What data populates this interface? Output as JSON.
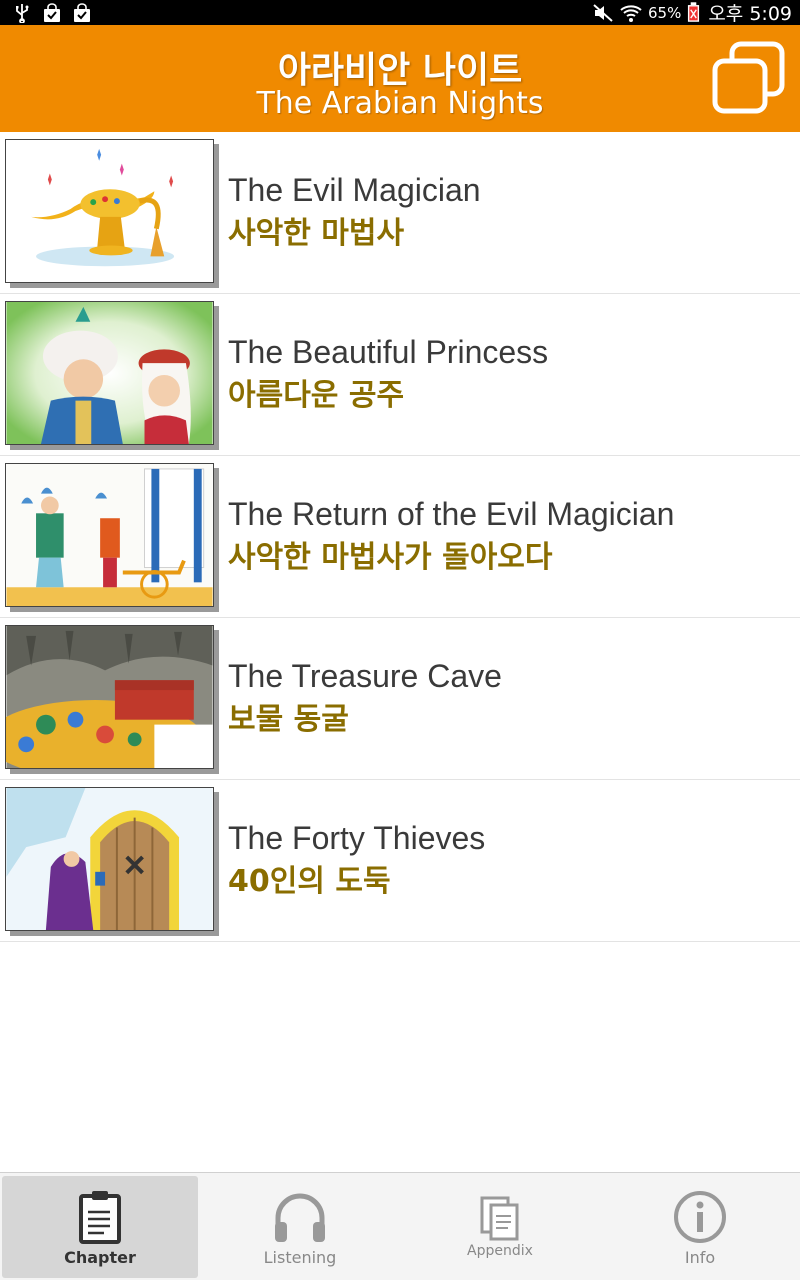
{
  "status_bar": {
    "battery_percent": "65%",
    "time": "오후 5:09"
  },
  "header": {
    "title_korean": "아라비안 나이트",
    "title_english": "The Arabian Nights",
    "window_button_icon": "overlapping-windows-icon"
  },
  "chapters": [
    {
      "title_en": "The Evil Magician",
      "title_ko": "사악한 마법사"
    },
    {
      "title_en": "The Beautiful Princess",
      "title_ko": "아름다운 공주"
    },
    {
      "title_en": "The Return of the Evil Magician",
      "title_ko": "사악한 마법사가 돌아오다"
    },
    {
      "title_en": "The Treasure Cave",
      "title_ko": "보물 동굴"
    },
    {
      "title_en": "The Forty Thieves",
      "title_ko": "40인의 도둑"
    }
  ],
  "bottom_nav": {
    "tabs": [
      {
        "label": "Chapter",
        "icon": "clipboard-icon",
        "active": true
      },
      {
        "label": "Listening",
        "icon": "headphones-icon",
        "active": false
      },
      {
        "label": "Appendix",
        "icon": "documents-icon",
        "active": false
      },
      {
        "label": "Info",
        "icon": "info-icon",
        "active": false
      }
    ]
  },
  "colors": {
    "header_bg": "#F08A00",
    "korean_subtitle": "#8a6d00",
    "english_title": "#3a3a3a"
  }
}
